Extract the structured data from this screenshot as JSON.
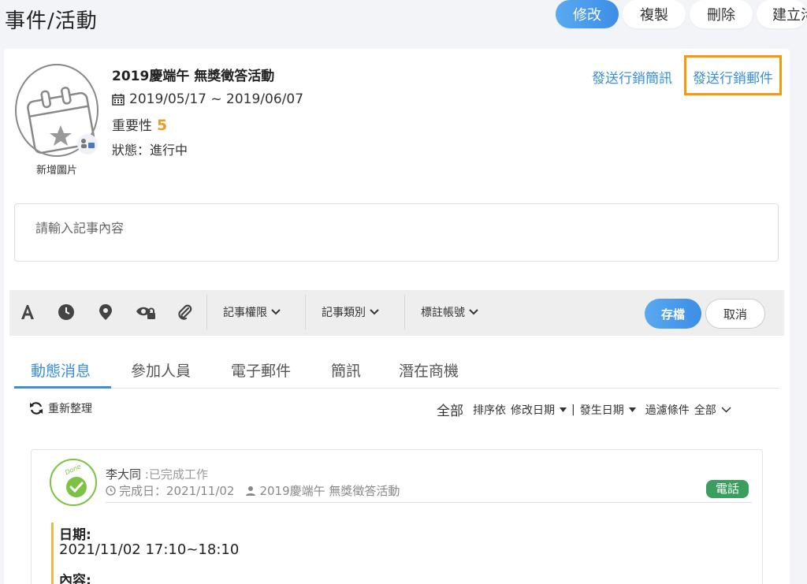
{
  "header": {
    "title": "事件/活動",
    "buttons": {
      "edit": "修改",
      "copy": "複製",
      "delete": "刪除",
      "create": "建立活動"
    }
  },
  "event": {
    "title": "2019慶端午 無獎徵答活動",
    "date_range": "2019/05/17 ~ 2019/06/07",
    "importance_label": "重要性",
    "importance_value": "5",
    "status": "狀態：進行中",
    "add_image": "新增圖片"
  },
  "actions": {
    "send_sms": "發送行銷簡訊",
    "send_email": "發送行銷郵件"
  },
  "note": {
    "placeholder": "請輸入記事內容"
  },
  "toolbar": {
    "permission": "記事權限",
    "category": "記事類別",
    "tag_account": "標註帳號",
    "save": "存檔",
    "cancel": "取消"
  },
  "tabs": [
    "動態消息",
    "參加人員",
    "電子郵件",
    "簡訊",
    "潛在商機"
  ],
  "feed": {
    "refresh": "重新整理",
    "all": "全部",
    "sort_by": "排序依",
    "sort_modified": "修改日期",
    "sep": "|",
    "sort_created": "發生日期",
    "filter": "過濾條件",
    "filter_value": "全部"
  },
  "activity": {
    "done_text": "Done",
    "user": "李大同",
    "action": ":已完成工作",
    "complete_date": "完成日：2021/11/02",
    "event_ref": "2019慶端午 無獎徵答活動",
    "badge": "電話",
    "date_label": "日期:",
    "date_value": "2021/11/02 17:10~18:10",
    "content_label": "內容:"
  },
  "colors": {
    "accent": "#3b8fd8",
    "highlight": "#f59a0c",
    "importance": "#e6a023",
    "badge": "#3a9e5f",
    "done": "#7cc243"
  }
}
